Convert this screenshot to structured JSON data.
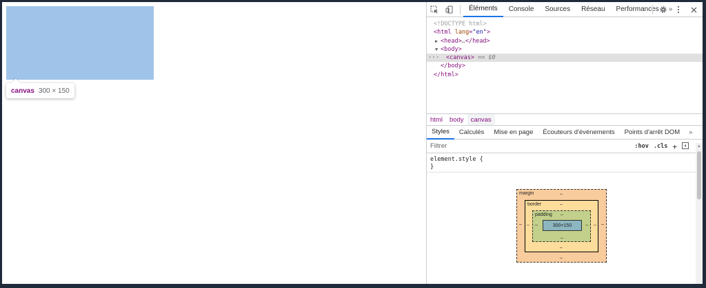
{
  "viewport": {
    "tooltip": {
      "tag": "canvas",
      "size": "300 × 150"
    },
    "highlight_color": "#a0c4e9"
  },
  "devtools": {
    "tabs": [
      "Éléments",
      "Console",
      "Sources",
      "Réseau",
      "Performances"
    ],
    "active_tab": "Éléments",
    "more_tabs": "»",
    "dom": {
      "doctype": "<!DOCTYPE html>",
      "html_open_tag": "<html",
      "html_attr": "lang",
      "html_attr_val": "\"en\"",
      "head_open": "<head>",
      "head_ellipsis": "…",
      "head_close": "</head>",
      "body_open": "<body>",
      "canvas": "<canvas>",
      "canvas_ref": "== $0",
      "body_close": "</body>",
      "html_close": "</html>",
      "row_menu": "···"
    },
    "breadcrumbs": [
      "html",
      "body",
      "canvas"
    ],
    "styles_tabs": [
      "Styles",
      "Calculés",
      "Mise en page",
      "Écouteurs d'événements",
      "Points d'arrêt DOM"
    ],
    "styles_more": "»",
    "filter": {
      "placeholder": "Filtrer",
      "hov": ":hov",
      "cls": ".cls",
      "plus": "+"
    },
    "element_style": {
      "selector": "element.style {",
      "close": "}"
    },
    "box_model": {
      "margin_label": "margin",
      "border_label": "border",
      "padding_label": "padding",
      "content": "300×150",
      "dash": "–"
    }
  }
}
